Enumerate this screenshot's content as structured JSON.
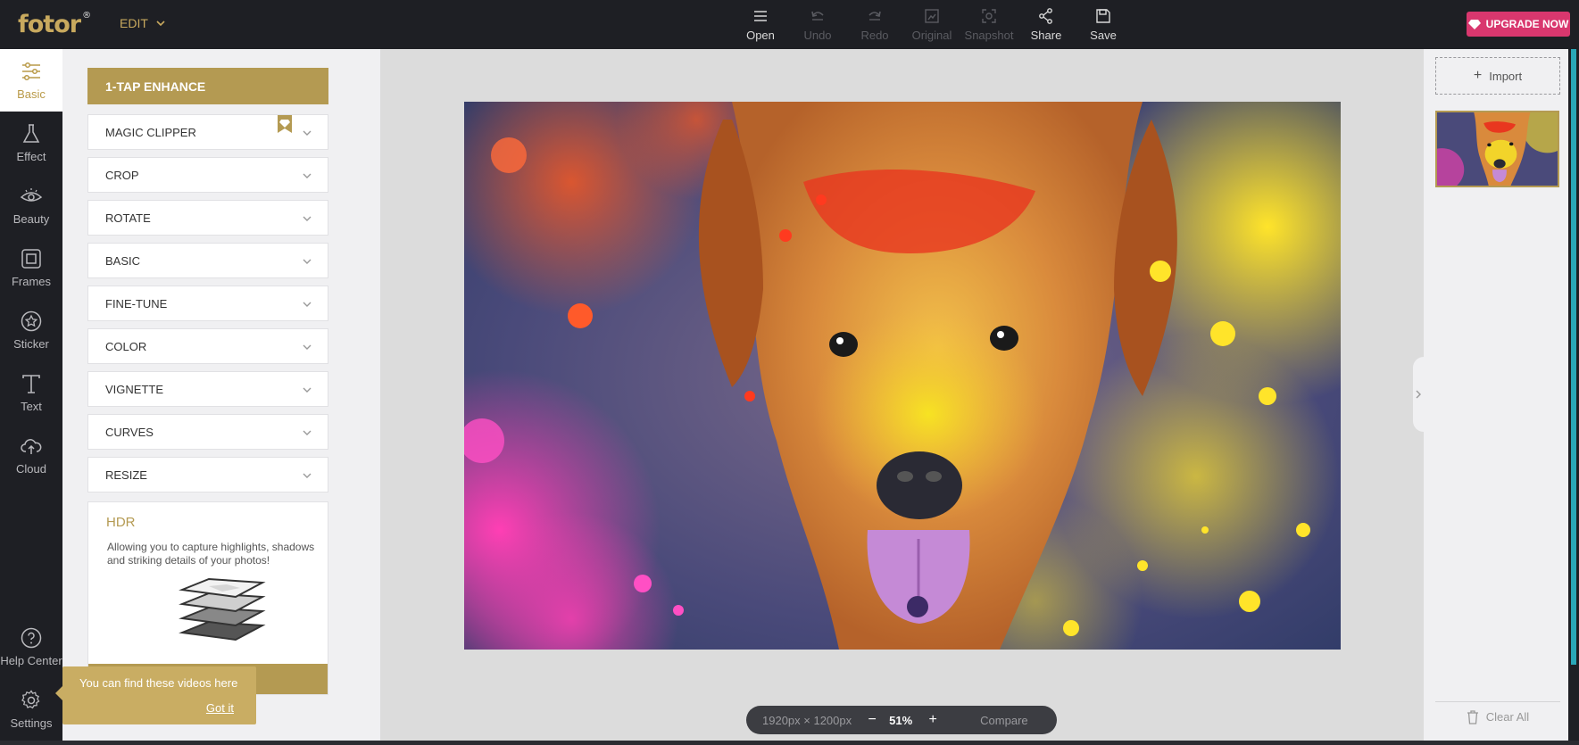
{
  "app": {
    "logo_text": "fotor",
    "logo_mark": "®",
    "mode_label": "EDIT"
  },
  "toolbar": [
    {
      "label": "Open",
      "icon": "menu-icon",
      "enabled": true
    },
    {
      "label": "Undo",
      "icon": "undo-icon",
      "enabled": false
    },
    {
      "label": "Redo",
      "icon": "redo-icon",
      "enabled": false
    },
    {
      "label": "Original",
      "icon": "image-icon",
      "enabled": false
    },
    {
      "label": "Snapshot",
      "icon": "snapshot-icon",
      "enabled": false
    },
    {
      "label": "Share",
      "icon": "share-icon",
      "enabled": true
    },
    {
      "label": "Save",
      "icon": "save-icon",
      "enabled": true
    }
  ],
  "upgrade_label": "UPGRADE NOW",
  "leftnav": [
    {
      "label": "Basic",
      "icon": "sliders-icon",
      "active": true
    },
    {
      "label": "Effect",
      "icon": "flask-icon",
      "active": false
    },
    {
      "label": "Beauty",
      "icon": "eye-icon",
      "active": false
    },
    {
      "label": "Frames",
      "icon": "frame-icon",
      "active": false
    },
    {
      "label": "Sticker",
      "icon": "star-icon",
      "active": false
    },
    {
      "label": "Text",
      "icon": "text-icon",
      "active": false
    },
    {
      "label": "Cloud",
      "icon": "cloud-icon",
      "active": false
    },
    {
      "label": "Help Center",
      "icon": "help-icon",
      "active": false
    },
    {
      "label": "Settings",
      "icon": "gear-icon",
      "active": false
    }
  ],
  "panel": {
    "enhance_label": "1-TAP ENHANCE",
    "sections": [
      "MAGIC CLIPPER",
      "CROP",
      "ROTATE",
      "BASIC",
      "FINE-TUNE",
      "COLOR",
      "VIGNETTE",
      "CURVES",
      "RESIZE"
    ],
    "hdr": {
      "title": "HDR",
      "description": "Allowing you to capture highlights, shadows and striking details of your photos!"
    }
  },
  "tooltip": {
    "text": "You can find these videos here",
    "link": "Got it"
  },
  "canvas": {
    "dimensions": "1920px × 1200px",
    "zoom_out": "−",
    "zoom": "51%",
    "zoom_in": "+",
    "compare_label": "Compare"
  },
  "right": {
    "import_label": "Import",
    "clear_label": "Clear All"
  },
  "colors": {
    "accent": "#b49a52",
    "upgrade": "#d9376e",
    "dark": "#1e1f24"
  }
}
